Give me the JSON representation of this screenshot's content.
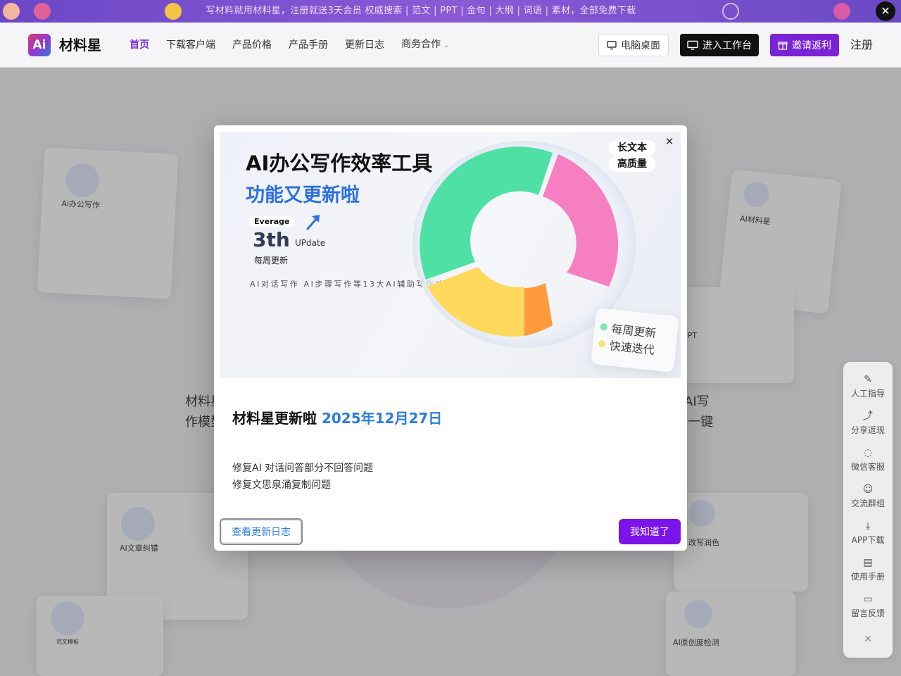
{
  "promo": {
    "text": "写材料就用材料星，注册就送3天会员   权威搜索 | 范文 | PPT | 金句 | 大纲 | 词语 | 素材，全部免费下载",
    "close_symbol": "✕"
  },
  "header": {
    "logo_mark": "Ai",
    "brand": "材料星",
    "nav": [
      "首页",
      "下载客户端",
      "产品价格",
      "产品手册",
      "更新日志",
      "商务合作"
    ],
    "nav_chevron": "⌄",
    "desktop_label": "电脑桌面",
    "workspace_label": "进入工作台",
    "invite_label": "邀请返利",
    "register_label": "注册"
  },
  "background": {
    "card_labels": [
      "Ai办公写作",
      "AI材料星",
      "PPT",
      "AI文章纠错",
      "改写润色",
      "范文模板",
      "AI原创度检测"
    ],
    "text_left": [
      "材料星",
      "作模型"
    ],
    "text_right": [
      "AI写",
      "I一键"
    ]
  },
  "sidebar": {
    "items": [
      {
        "label": "人工指导",
        "icon": "pencil-icon",
        "glyph": "✎"
      },
      {
        "label": "分享返现",
        "icon": "share-icon",
        "glyph": "⤴"
      },
      {
        "label": "微信客服",
        "icon": "chat-icon",
        "glyph": "◌"
      },
      {
        "label": "交流群组",
        "icon": "group-icon",
        "glyph": "☺"
      },
      {
        "label": "APP下载",
        "icon": "download-icon",
        "glyph": "⤓"
      },
      {
        "label": "使用手册",
        "icon": "manual-icon",
        "glyph": "▤"
      },
      {
        "label": "留言反馈",
        "icon": "feedback-icon",
        "glyph": "▭"
      }
    ],
    "close_symbol": "✕"
  },
  "modal": {
    "hero": {
      "title": "AI办公写作效率工具",
      "subtitle": "功能又更新啦",
      "badge": "Everage",
      "big": "3th",
      "update": "UPdate",
      "weekly": "每周更新",
      "desc": "AI对话写作  AI步骤写作等13大AI辅助写作功能",
      "tag1": "长文本",
      "tag2": "高质量",
      "glass1": "每周更新",
      "glass2": "快速迭代",
      "close_symbol": "✕",
      "colors": {
        "green": "#4fe0a6",
        "pink": "#f67fc2",
        "yellow": "#ffd85e",
        "orange": "#ff9a3d"
      }
    },
    "title": "材料星更新啦",
    "date": "2025年12月27日",
    "lines": [
      "修复AI 对话问答部分不回答问题",
      "修复文思泉涌复制问题"
    ],
    "view_log_label": "查看更新日志",
    "ok_label": "我知道了"
  }
}
